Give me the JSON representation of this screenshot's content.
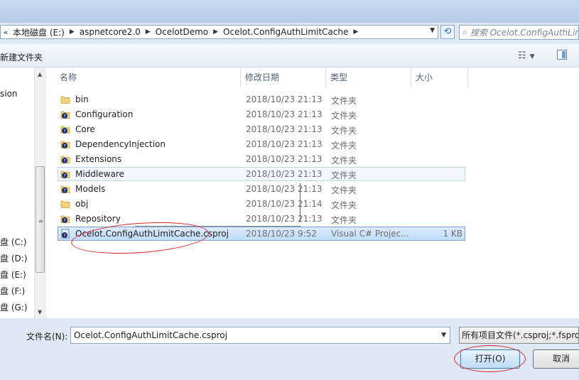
{
  "address": {
    "crumbs": [
      "本地磁盘 (E:)",
      "aspnetcore2.0",
      "OcelotDemo",
      "Ocelot.ConfigAuthLimitCache"
    ],
    "search_placeholder": "搜索 Ocelot.ConfigAuthLimitCache"
  },
  "toolbar": {
    "new_folder": "新建文件夹"
  },
  "nav": {
    "items": [
      {
        "label": "sion"
      },
      {
        "label": "盘 (C:)"
      },
      {
        "label": "盘 (D:)"
      },
      {
        "label": "盘 (E:)"
      },
      {
        "label": "盘 (F:)"
      },
      {
        "label": "盘 (G:)"
      }
    ]
  },
  "columns": {
    "name": "名称",
    "date": "修改日期",
    "type": "类型",
    "size": "大小"
  },
  "files": [
    {
      "name": "bin",
      "date": "2018/10/23 21:13",
      "type": "文件夹",
      "size": "",
      "icon": "folder-icon"
    },
    {
      "name": "Configuration",
      "date": "2018/10/23 21:13",
      "type": "文件夹",
      "size": "",
      "icon": "folder-vcs-icon"
    },
    {
      "name": "Core",
      "date": "2018/10/23 21:13",
      "type": "文件夹",
      "size": "",
      "icon": "folder-vcs-icon"
    },
    {
      "name": "DependencyInjection",
      "date": "2018/10/23 21:13",
      "type": "文件夹",
      "size": "",
      "icon": "folder-vcs-icon"
    },
    {
      "name": "Extensions",
      "date": "2018/10/23 21:13",
      "type": "文件夹",
      "size": "",
      "icon": "folder-vcs-icon"
    },
    {
      "name": "Middleware",
      "date": "2018/10/23 21:13",
      "type": "文件夹",
      "size": "",
      "icon": "folder-vcs-icon"
    },
    {
      "name": "Models",
      "date": "2018/10/23 21:13",
      "type": "文件夹",
      "size": "",
      "icon": "folder-vcs-icon"
    },
    {
      "name": "obj",
      "date": "2018/10/23 21:14",
      "type": "文件夹",
      "size": "",
      "icon": "folder-icon"
    },
    {
      "name": "Repository",
      "date": "2018/10/23 21:13",
      "type": "文件夹",
      "size": "",
      "icon": "folder-vcs-icon"
    },
    {
      "name": "Ocelot.ConfigAuthLimitCache.csproj",
      "date": "2018/10/23 9:52",
      "type": "Visual C# Projec...",
      "size": "1 KB",
      "icon": "csproj-file-icon"
    }
  ],
  "bottom": {
    "filename_label": "文件名(N):",
    "filename_value": "Ocelot.ConfigAuthLimitCache.csproj",
    "filter_value": "所有项目文件(*.csproj;*.fsproj",
    "open_label": "打开(O)",
    "cancel_label": "取消"
  },
  "colors": {
    "selection": "#c1dcfc",
    "annotation": "#d9262a",
    "accent": "#3c7fb1"
  }
}
